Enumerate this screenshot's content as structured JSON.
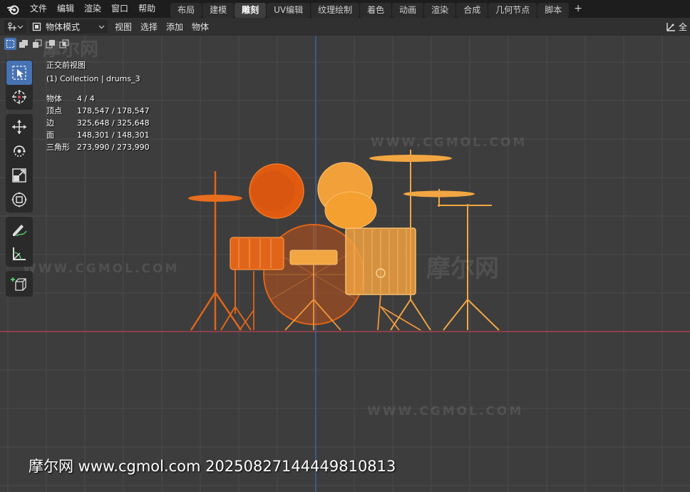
{
  "app": {
    "logo_icon": "blender-logo-icon"
  },
  "menu": [
    "文件",
    "编辑",
    "渲染",
    "窗口",
    "帮助"
  ],
  "workspace_tabs": [
    {
      "label": "布局",
      "active": false
    },
    {
      "label": "建模",
      "active": false
    },
    {
      "label": "雕刻",
      "active": true
    },
    {
      "label": "UV编辑",
      "active": false
    },
    {
      "label": "纹理绘制",
      "active": false
    },
    {
      "label": "着色",
      "active": false
    },
    {
      "label": "动画",
      "active": false
    },
    {
      "label": "渲染",
      "active": false
    },
    {
      "label": "合成",
      "active": false
    },
    {
      "label": "几何节点",
      "active": false
    },
    {
      "label": "脚本",
      "active": false
    }
  ],
  "add_workspace": "+",
  "header": {
    "mode": "物体模式",
    "menus": [
      "视图",
      "选择",
      "添加",
      "物体"
    ],
    "right_label": "全"
  },
  "viewport": {
    "view_name": "正交前视图",
    "collection": "(1) Collection | drums_3",
    "stats": [
      {
        "label": "物体",
        "value": "4 / 4"
      },
      {
        "label": "顶点",
        "value": "178,547 / 178,547"
      },
      {
        "label": "边",
        "value": "325,648 / 325,648"
      },
      {
        "label": "面",
        "value": "148,301 / 148,301"
      },
      {
        "label": "三角形",
        "value": "273,990 / 273,990"
      }
    ]
  },
  "tools": [
    {
      "name": "select-box-tool",
      "icon": "select-box-icon",
      "active": true
    },
    {
      "name": "cursor-tool",
      "icon": "cursor-icon",
      "active": false
    },
    {
      "name": "move-tool",
      "icon": "move-icon",
      "active": false
    },
    {
      "name": "rotate-tool",
      "icon": "rotate-icon",
      "active": false
    },
    {
      "name": "scale-tool",
      "icon": "scale-icon",
      "active": false
    },
    {
      "name": "transform-tool",
      "icon": "transform-icon",
      "active": false
    },
    {
      "name": "annotate-tool",
      "icon": "annotate-icon",
      "active": false
    },
    {
      "name": "measure-tool",
      "icon": "measure-icon",
      "active": false
    },
    {
      "name": "add-cube-tool",
      "icon": "add-cube-icon",
      "active": false
    }
  ],
  "watermarks": {
    "text": "WWW.CGMOL.COM",
    "logo_text": "摩尔网",
    "footer": "摩尔网 www.cgmol.com 20250827144449810813"
  },
  "colors": {
    "accent": "#4772b3",
    "axis_x": "#b8434f",
    "axis_z": "#3c6fb5",
    "drum_orange": "#f08a1c",
    "drum_red_orange": "#e05a10"
  }
}
